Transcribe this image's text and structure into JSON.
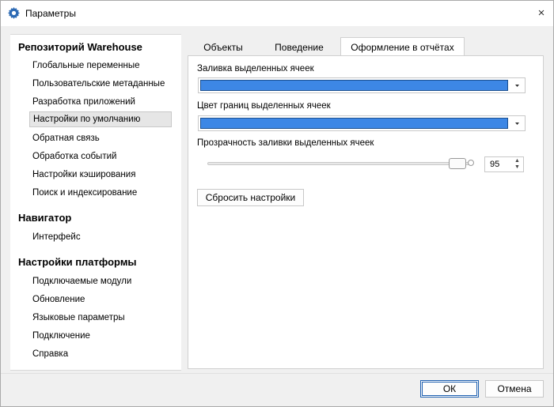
{
  "window": {
    "title": "Параметры",
    "close_icon": "×",
    "app_icon": "gear-icon",
    "accent": "#1d5fb0"
  },
  "sidebar": {
    "groups": [
      {
        "title": "Репозиторий Warehouse",
        "items": [
          "Глобальные переменные",
          "Пользовательские метаданные",
          "Разработка приложений",
          "Настройки по умолчанию",
          "Обратная связь",
          "Обработка событий",
          "Настройки кэширования",
          "Поиск и индексирование"
        ]
      },
      {
        "title": "Навигатор",
        "items": [
          "Интерфейс"
        ]
      },
      {
        "title": "Настройки платформы",
        "items": [
          "Подключаемые модули",
          "Обновление",
          "Языковые параметры",
          "Подключение",
          "Справка"
        ]
      }
    ],
    "selected_item": "Настройки по умолчанию"
  },
  "tabs": {
    "items": [
      "Объекты",
      "Поведение",
      "Оформление в отчётах"
    ],
    "active": "Оформление в отчётах"
  },
  "panel": {
    "fill_label": "Заливка выделенных ячеек",
    "fill_color": "#3d87e5",
    "border_label": "Цвет границ выделенных ячеек",
    "border_color": "#3d87e5",
    "transparency_label": "Прозрачность заливки выделенных ячеек",
    "transparency_value": "95",
    "transparency_fraction": 0.95,
    "reset_button": "Сбросить настройки"
  },
  "footer": {
    "ok": "ОК",
    "cancel": "Отмена"
  }
}
